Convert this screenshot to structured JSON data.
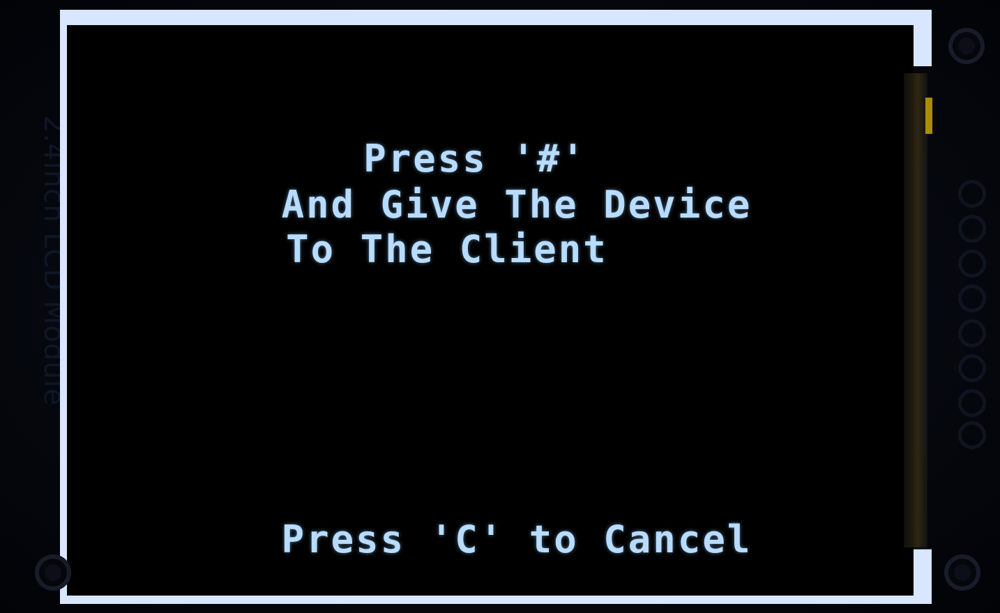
{
  "device": {
    "pcb_label": "2.4inch LCD Module"
  },
  "screen": {
    "instruction_lines": [
      "Press '#'",
      "And Give The Device",
      "To The Client"
    ],
    "cancel_hint": "Press 'C' to Cancel"
  },
  "colors": {
    "text": "#b8dcff",
    "background": "#000000"
  }
}
